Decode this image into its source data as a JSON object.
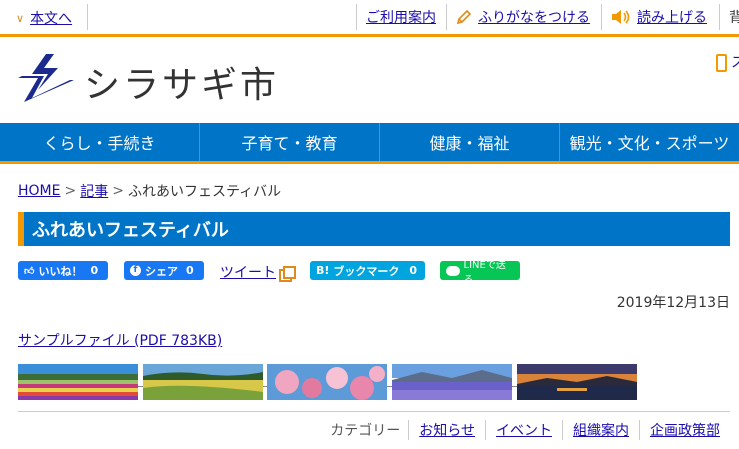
{
  "topbar": {
    "skip_link": "本文へ",
    "guide": "ご利用案内",
    "furigana": "ふりがなをつける",
    "read_aloud": "読み上げる",
    "background_partial": "背"
  },
  "header": {
    "site_name": "シラサギ市",
    "mobile_partial": "ス"
  },
  "nav": {
    "items": [
      {
        "label": "くらし・手続き"
      },
      {
        "label": "子育て・教育"
      },
      {
        "label": "健康・福祉"
      },
      {
        "label": "観光・文化・スポーツ"
      }
    ]
  },
  "breadcrumb": {
    "home": "HOME",
    "articles": "記事",
    "current": "ふれあいフェスティバル",
    "sep": ">"
  },
  "page": {
    "title": "ふれあいフェスティバル",
    "date": "2019年12月13日",
    "file_link": "サンプルファイル (PDF 783KB)"
  },
  "social": {
    "fb_like": "いいね！",
    "fb_like_count": "0",
    "fb_share": "シェア",
    "fb_share_count": "0",
    "tweet": "ツイート",
    "hatena": "ブックマーク",
    "hatena_badge": "B!",
    "hatena_count": "0",
    "line": "LINEで送る",
    "colors": {
      "facebook": "#1877f2",
      "hatena": "#00a4de",
      "line": "#06c755"
    }
  },
  "categories": {
    "label": "カテゴリー",
    "items": [
      "お知らせ",
      "イベント",
      "組織案内",
      "企画政策部"
    ]
  },
  "colors": {
    "primary": "#0075c8",
    "accent": "#f39800",
    "link": "#1a0dab"
  }
}
